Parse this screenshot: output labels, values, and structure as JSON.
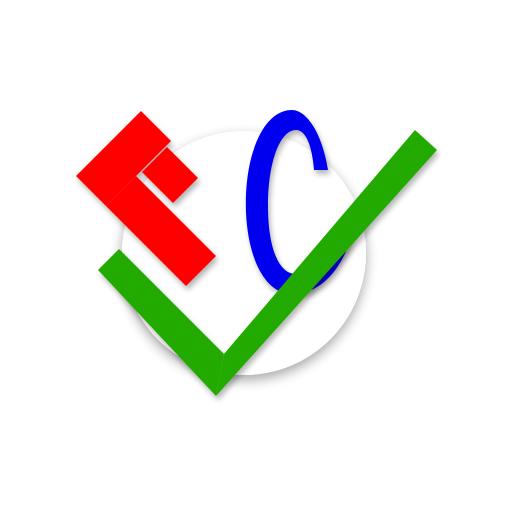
{
  "logo": {
    "lettering": "FC",
    "icon_names": [
      "circle-badge",
      "letter-f-glyph",
      "letter-c-glyph",
      "checkmark-icon"
    ],
    "colors": {
      "background": "#ffffff",
      "circle": "#ffffff",
      "circle_shadow": "#9e9e9e",
      "letter_f": "#ff0000",
      "letter_c": "#0000ee",
      "checkmark": "#22aa00"
    }
  }
}
